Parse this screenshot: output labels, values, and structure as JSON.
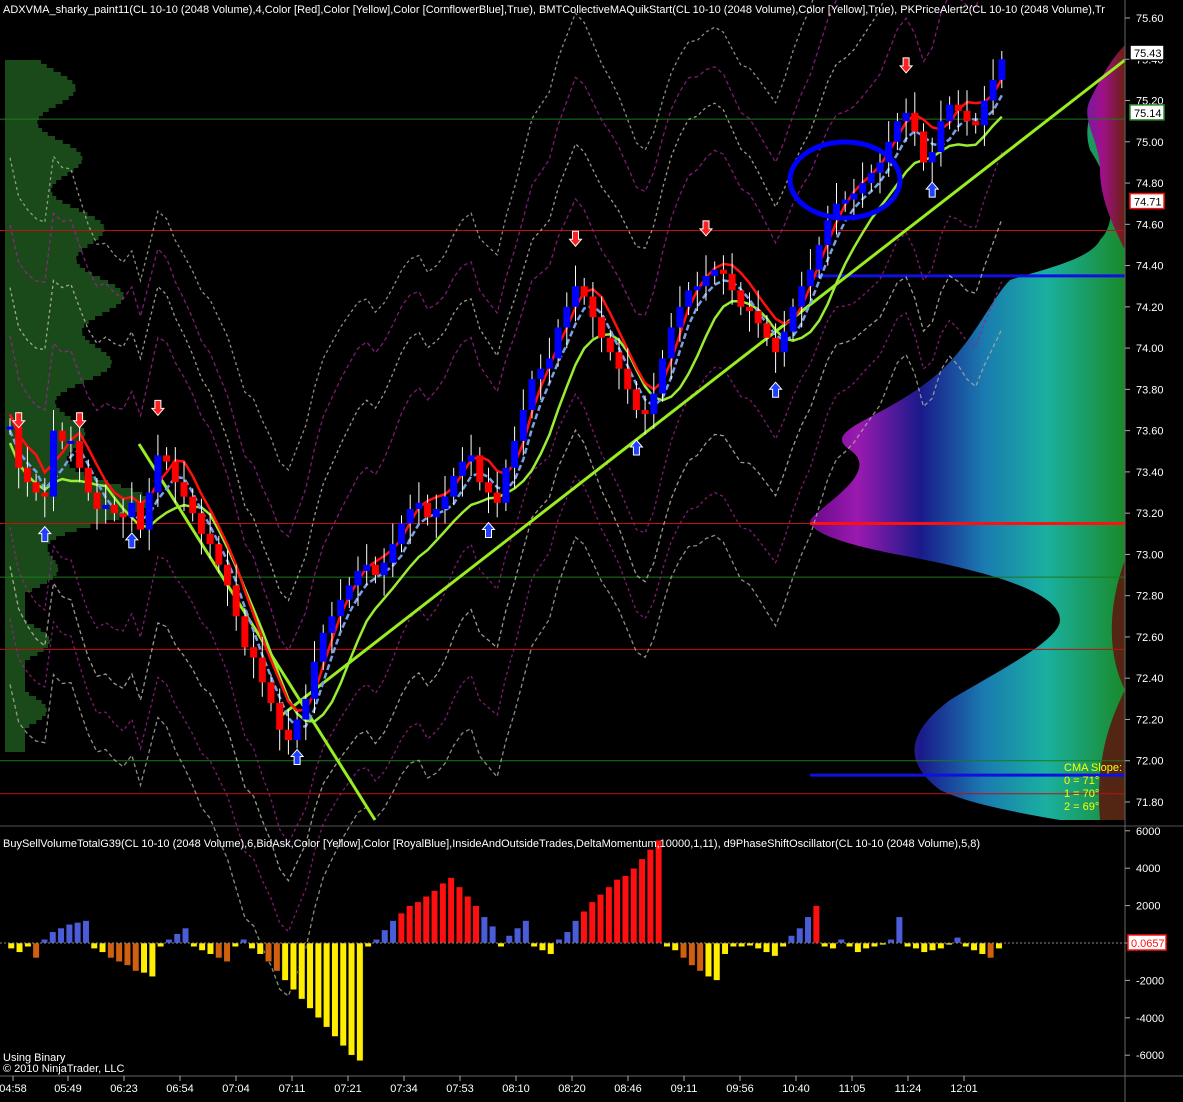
{
  "header": {
    "price_panel": "ADXVMA_sharky_paint11(CL 10-10 (2048 Volume),4,Color [Red],Color [Yellow],Color [CornflowerBlue],True), BMTCollectiveMAQuikStart(CL 10-10 (2048 Volume),Color [Yellow],True), PKPriceAlert2(CL 10-10 (2048 Volume),Tr",
    "volume_panel": "BuySellVolumeTotalG39(CL 10-10 (2048 Volume),6,BidAsk,Color [Yellow],Color [RoyalBlue],InsideAndOutsideTrades,DeltaMomentum,10000,1,11), d9PhaseShiftOscillator(CL 10-10 (2048 Volume),5,8)"
  },
  "cma": {
    "title": "CMA Slope:",
    "lines": [
      "0 = 71°",
      "1 = 70°",
      "2 = 69°"
    ]
  },
  "footer": {
    "line1": "Using Binary",
    "line2": "© 2010 NinjaTrader, LLC"
  },
  "colors": {
    "background": "#000000",
    "up_candle": "#0000ff",
    "down_candle": "#ff0000",
    "trendline": "#99ee22",
    "price_marker": "#ff0000",
    "buy_volume": "#4a5cd8",
    "sell_volume": "#ffee00"
  },
  "chart_data": [
    {
      "type": "candlestick",
      "panel": "price",
      "ylim": [
        71.68,
        75.6
      ],
      "y_ticks": [
        "75.60",
        "75.40",
        "75.20",
        "75.00",
        "74.80",
        "74.60",
        "74.40",
        "74.20",
        "74.00",
        "73.80",
        "73.60",
        "73.40",
        "73.20",
        "73.00",
        "72.80",
        "72.60",
        "72.40",
        "72.20",
        "72.00",
        "71.80"
      ],
      "x_ticks": [
        "04:58",
        "05:49",
        "06:23",
        "06:54",
        "07:04",
        "07:11",
        "07:21",
        "07:34",
        "07:53",
        "08:10",
        "08:20",
        "08:46",
        "09:11",
        "09:56",
        "10:40",
        "11:05",
        "11:24",
        "12:01"
      ],
      "price_markers": [
        "75.43",
        "75.14",
        "74.71"
      ],
      "close_path": [
        [
          0,
          73.62
        ],
        [
          1,
          73.42
        ],
        [
          2,
          73.35
        ],
        [
          3,
          73.3
        ],
        [
          4,
          73.28
        ],
        [
          5,
          73.6
        ],
        [
          6,
          73.55
        ],
        [
          7,
          73.55
        ],
        [
          8,
          73.42
        ],
        [
          9,
          73.3
        ],
        [
          10,
          73.22
        ],
        [
          11,
          73.24
        ],
        [
          12,
          73.2
        ],
        [
          13,
          73.18
        ],
        [
          14,
          73.25
        ],
        [
          15,
          73.12
        ],
        [
          16,
          73.3
        ],
        [
          17,
          73.48
        ],
        [
          18,
          73.45
        ],
        [
          19,
          73.35
        ],
        [
          20,
          73.28
        ],
        [
          21,
          73.2
        ],
        [
          22,
          73.1
        ],
        [
          23,
          73.05
        ],
        [
          24,
          72.95
        ],
        [
          25,
          72.85
        ],
        [
          26,
          72.7
        ],
        [
          27,
          72.55
        ],
        [
          28,
          72.5
        ],
        [
          29,
          72.38
        ],
        [
          30,
          72.28
        ],
        [
          31,
          72.15
        ],
        [
          32,
          72.1
        ],
        [
          33,
          72.2
        ],
        [
          34,
          72.3
        ],
        [
          35,
          72.48
        ],
        [
          36,
          72.62
        ],
        [
          37,
          72.7
        ],
        [
          38,
          72.78
        ],
        [
          39,
          72.85
        ],
        [
          40,
          72.92
        ],
        [
          41,
          72.95
        ],
        [
          42,
          72.9
        ],
        [
          43,
          72.96
        ],
        [
          44,
          73.05
        ],
        [
          45,
          73.15
        ],
        [
          46,
          73.22
        ],
        [
          47,
          73.25
        ],
        [
          48,
          73.18
        ],
        [
          49,
          73.22
        ],
        [
          50,
          73.28
        ],
        [
          51,
          73.38
        ],
        [
          52,
          73.45
        ],
        [
          53,
          73.48
        ],
        [
          54,
          73.35
        ],
        [
          55,
          73.3
        ],
        [
          56,
          73.25
        ],
        [
          57,
          73.42
        ],
        [
          58,
          73.55
        ],
        [
          59,
          73.7
        ],
        [
          60,
          73.85
        ],
        [
          61,
          73.9
        ],
        [
          62,
          73.95
        ],
        [
          63,
          74.1
        ],
        [
          64,
          74.2
        ],
        [
          65,
          74.3
        ],
        [
          66,
          74.25
        ],
        [
          67,
          74.15
        ],
        [
          68,
          74.05
        ],
        [
          69,
          73.98
        ],
        [
          70,
          73.9
        ],
        [
          71,
          73.8
        ],
        [
          72,
          73.7
        ],
        [
          73,
          73.68
        ],
        [
          74,
          73.78
        ],
        [
          75,
          73.95
        ],
        [
          76,
          74.1
        ],
        [
          77,
          74.2
        ],
        [
          78,
          74.28
        ],
        [
          79,
          74.3
        ],
        [
          80,
          74.35
        ],
        [
          81,
          74.38
        ],
        [
          82,
          74.36
        ],
        [
          83,
          74.28
        ],
        [
          84,
          74.2
        ],
        [
          85,
          74.18
        ],
        [
          86,
          74.12
        ],
        [
          87,
          74.05
        ],
        [
          88,
          73.98
        ],
        [
          89,
          74.08
        ],
        [
          90,
          74.2
        ],
        [
          91,
          74.3
        ],
        [
          92,
          74.38
        ],
        [
          93,
          74.5
        ],
        [
          94,
          74.62
        ],
        [
          95,
          74.7
        ],
        [
          96,
          74.72
        ],
        [
          97,
          74.75
        ],
        [
          98,
          74.8
        ],
        [
          99,
          74.85
        ],
        [
          100,
          74.9
        ],
        [
          101,
          75.0
        ],
        [
          102,
          75.1
        ],
        [
          103,
          75.14
        ],
        [
          104,
          75.05
        ],
        [
          105,
          74.9
        ],
        [
          106,
          74.95
        ],
        [
          107,
          75.1
        ],
        [
          108,
          75.18
        ],
        [
          109,
          75.15
        ],
        [
          110,
          75.1
        ],
        [
          111,
          75.08
        ],
        [
          112,
          75.2
        ],
        [
          113,
          75.3
        ],
        [
          114,
          75.4
        ]
      ],
      "horizontal_levels": [
        {
          "price": 75.11,
          "color": "green"
        },
        {
          "price": 74.57,
          "color": "red"
        },
        {
          "price": 74.35,
          "color": "blue"
        },
        {
          "price": 73.15,
          "color": "red"
        },
        {
          "price": 72.89,
          "color": "green"
        },
        {
          "price": 72.54,
          "color": "red"
        },
        {
          "price": 72.0,
          "color": "green"
        },
        {
          "price": 71.93,
          "color": "blue"
        },
        {
          "price": 71.84,
          "color": "red"
        }
      ]
    },
    {
      "type": "bar",
      "panel": "volume_oscillator",
      "ylim": [
        -7000,
        7000
      ],
      "y_ticks": [
        "6000",
        "4000",
        "2000",
        "0",
        "-2000",
        "-4000",
        "-6000"
      ],
      "value_marker": "0.0657",
      "values": [
        -300,
        -500,
        -200,
        -800,
        200,
        600,
        800,
        1000,
        1100,
        1200,
        -300,
        -500,
        -800,
        -1000,
        -1200,
        -1500,
        -1600,
        -1800,
        -200,
        200,
        500,
        800,
        -200,
        -400,
        -600,
        -800,
        -1000,
        -200,
        200,
        -300,
        -600,
        -1000,
        -1500,
        -2000,
        -2500,
        -3000,
        -3500,
        -4000,
        -4500,
        -5000,
        -5500,
        -6000,
        -6300,
        -200,
        200,
        700,
        1200,
        1600,
        2000,
        2200,
        2500,
        2800,
        3200,
        3500,
        3000,
        2500,
        2000,
        1400,
        900,
        -200,
        400,
        800,
        1200,
        -200,
        -400,
        -600,
        200,
        600,
        1200,
        1700,
        2200,
        2600,
        3000,
        3400,
        3600,
        4000,
        4500,
        5000,
        5500,
        -200,
        -400,
        -800,
        -1200,
        -1500,
        -1800,
        -2000,
        -600,
        -200,
        -200,
        -150,
        -300,
        -500,
        -700,
        -200,
        400,
        800,
        1400,
        2000,
        -200,
        -300,
        200,
        -200,
        -500,
        -300,
        -200,
        -100,
        200,
        1400,
        -200,
        -300,
        -500,
        -400,
        -300,
        -100,
        300,
        -200,
        -400,
        -600,
        -800,
        -300
      ]
    }
  ]
}
